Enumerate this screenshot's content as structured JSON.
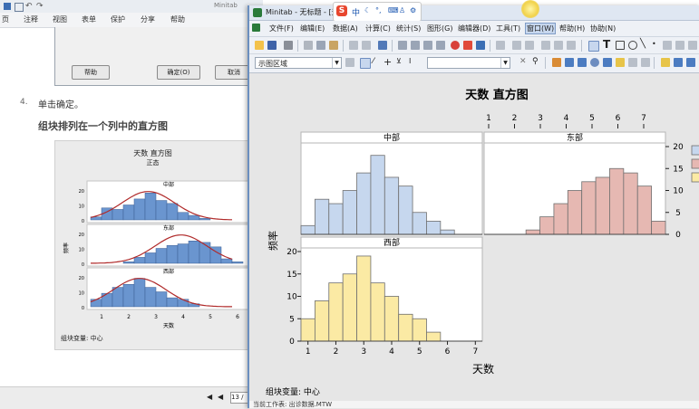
{
  "help": {
    "window_title": "Minitab",
    "menu": [
      "页",
      "注释",
      "视图",
      "表单",
      "保护",
      "分享",
      "帮助"
    ],
    "dialog_buttons": [
      "帮助",
      "确定(O)",
      "取消"
    ],
    "step_number": "4.",
    "step_text": "单击确定。",
    "section_heading": "组块排列在一个列中的直方图",
    "thumbnail": {
      "title": "天数 直方图",
      "subtitle": "正态",
      "panels": [
        "中部",
        "东部",
        "西部"
      ],
      "y_label": "频率",
      "x_label": "天数",
      "x_ticks": [
        "1",
        "2",
        "3",
        "4",
        "5",
        "6"
      ],
      "y_ticks": [
        "20",
        "10",
        "0"
      ],
      "block_note": "组块变量: 中心"
    },
    "page_indicator": "13 /"
  },
  "minitab": {
    "title": "Minitab - 无标题 - [天数 直方图]",
    "menu": [
      "文件(F)",
      "编辑(E)",
      "数据(A)",
      "计算(C)",
      "统计(S)",
      "图形(G)",
      "编辑器(D)",
      "工具(T)",
      "窗口(W)",
      "帮助(H)",
      "协助(N)"
    ],
    "toolbar_combo_left": "示图区域",
    "toolbar_combo_mid": "",
    "status_bar": "当前工作表: 出诊数据.MTW"
  },
  "chart_data": {
    "type": "bar",
    "title": "天数 直方图",
    "xlabel": "天数",
    "ylabel": "频率",
    "block_note": "组块变量: 中心",
    "x_ticks": [
      1,
      2,
      3,
      4,
      5,
      6,
      7
    ],
    "y_ticks": [
      0,
      5,
      10,
      15,
      20
    ],
    "ylim": [
      0,
      20
    ],
    "bin_edges": [
      0.75,
      1.25,
      1.75,
      2.25,
      2.75,
      3.25,
      3.75,
      4.25,
      4.75,
      5.25,
      5.75,
      6.25,
      6.75,
      7.25
    ],
    "series": [
      {
        "name": "中部",
        "color": "#c6d7ee",
        "values": [
          2,
          8,
          7,
          10,
          14,
          18,
          13,
          11,
          5,
          3,
          1,
          0,
          0
        ]
      },
      {
        "name": "东部",
        "color": "#e6b8b2",
        "values": [
          0,
          0,
          0,
          1,
          4,
          7,
          10,
          12,
          13,
          15,
          14,
          11,
          3,
          1
        ]
      },
      {
        "name": "西部",
        "color": "#fbeaa4",
        "values": [
          5,
          9,
          13,
          15,
          19,
          13,
          10,
          6,
          5,
          2,
          0,
          0,
          0
        ]
      }
    ],
    "legend_colors": [
      "#c6d7ee",
      "#e6b8b2",
      "#fbeaa4"
    ]
  }
}
